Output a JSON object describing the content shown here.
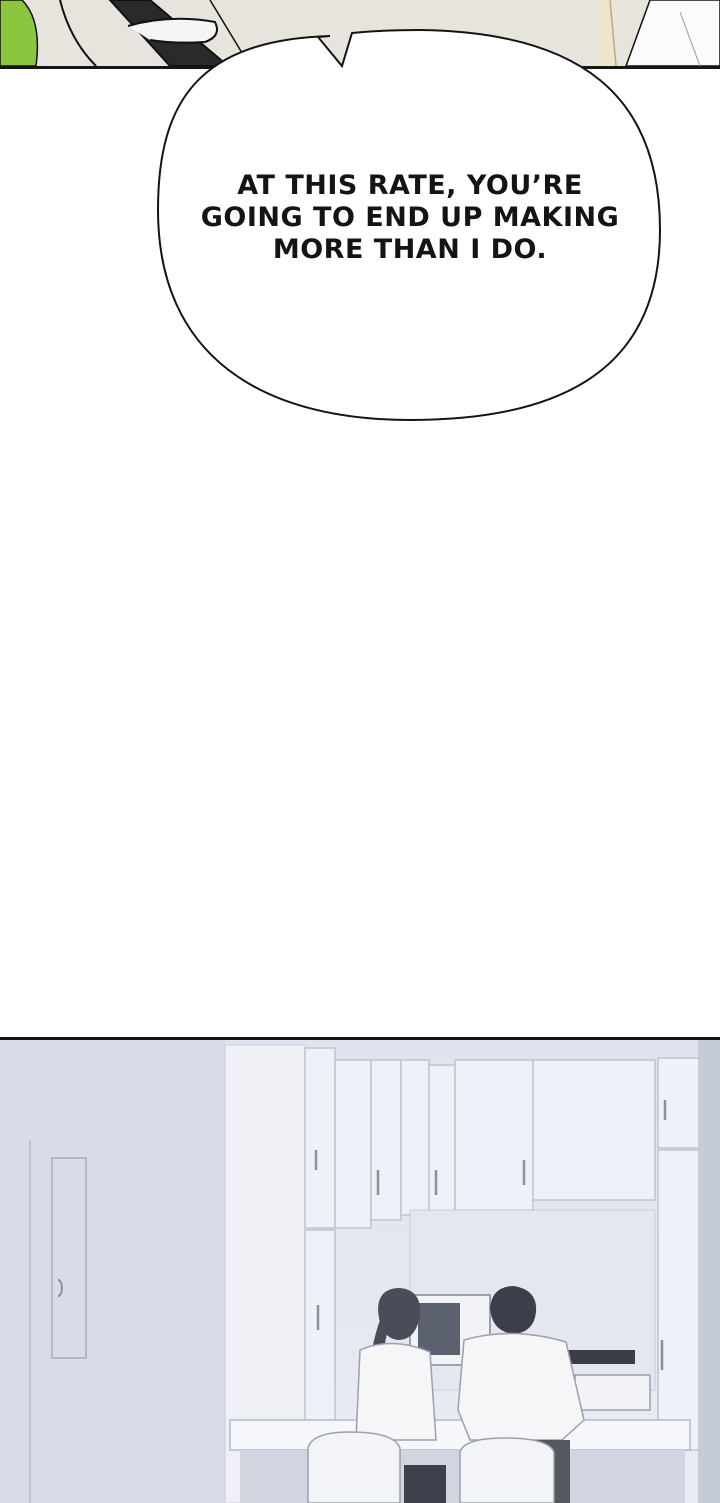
{
  "speech_bubble": {
    "text": "AT THIS RATE, YOU’RE\nGOING TO END UP MAKING\nMORE THAN I DO."
  },
  "colors": {
    "panel_border": "#161616",
    "bubble_fill": "#ffffff",
    "top_panel_bg": "#e6e4dc",
    "kitchen_bg": "#dfe3ee",
    "plant_green": "#8cc63f"
  }
}
